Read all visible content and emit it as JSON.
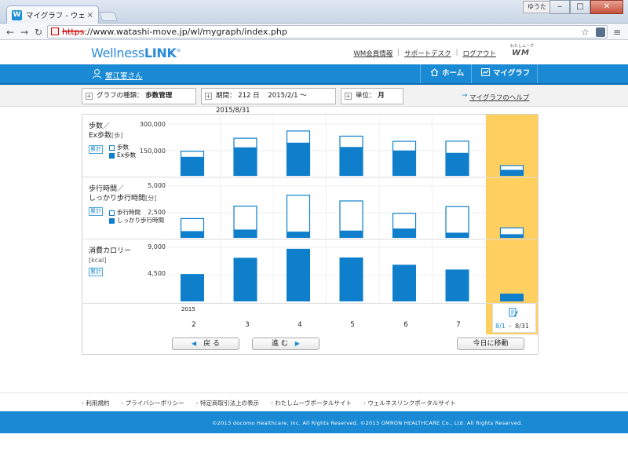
{
  "browser": {
    "tab_title": "マイグラフ - ウェルネス",
    "tab_close": "×",
    "user_badge": "ゆうた",
    "win_minimize": "‒",
    "win_maximize": "□",
    "win_close": "✕",
    "url_protocol": "https",
    "url_rest": "://www.watashi-move.jp/wl/mygraph/index.php",
    "back_icon": "arrow-left-icon",
    "forward_icon": "arrow-right-icon",
    "reload_icon": "reload-icon",
    "back_glyph": "←",
    "forward_glyph": "→",
    "reload_glyph": "↻",
    "star_glyph": "☆",
    "menu_glyph": "≡"
  },
  "header": {
    "logo_light": "Wellness",
    "logo_bold": "LINK",
    "logo_mark": "®",
    "links": [
      "WM会員情報",
      "サポートデスク",
      "ログアウト"
    ],
    "wm_logo_text": "WM",
    "wm_logo_small": "わたしムーヴ"
  },
  "nav": {
    "username": "蟹江軍さん",
    "home": "ホーム",
    "mygraph": "マイグラフ"
  },
  "filters": {
    "type_label": "グラフの種類：",
    "type_value": "歩数管理",
    "period_label": "期間：",
    "period_days": "212 日",
    "period_range": "2015/2/1 〜 2015/8/31",
    "unit_label": "単位：",
    "unit_value": "月",
    "help": "マイグラフのヘルプ"
  },
  "graph": {
    "rows": [
      {
        "title": "歩数／",
        "title2": "Ex歩数",
        "unit": "[歩]",
        "badge": "累計",
        "legend": [
          "歩数",
          "Ex歩数"
        ],
        "ticks": [
          "300,000",
          "150,000"
        ]
      },
      {
        "title": "歩行時間／",
        "title2": "しっかり歩行時間",
        "unit": "[分]",
        "badge": "累計",
        "legend": [
          "歩行時間",
          "しっかり歩行時間"
        ],
        "ticks": [
          "5,000",
          "2,500"
        ]
      },
      {
        "title": "消費カロリー",
        "title2": "",
        "unit": "[kcal]",
        "badge": "累計",
        "legend": [],
        "ticks": [
          "9,000",
          "4,500"
        ]
      }
    ],
    "year": "2015",
    "months": [
      "2",
      "3",
      "4",
      "5",
      "6",
      "7"
    ],
    "current_period_start": "8/1",
    "current_period_dash": "-",
    "current_period_end": "8/31",
    "buttons": {
      "back": "戻 る",
      "next": "進 む",
      "today": "今日に移動"
    },
    "back_arrow": "◀",
    "next_arrow": "▶"
  },
  "chart_data": [
    {
      "type": "bar",
      "ylabel": "歩数／Ex歩数 [歩]",
      "categories": [
        "2",
        "3",
        "4",
        "5",
        "6",
        "7",
        "8"
      ],
      "ylim": [
        0,
        300000
      ],
      "series": [
        {
          "name": "歩数",
          "values": [
            145000,
            220000,
            262000,
            232000,
            202000,
            203000,
            62000
          ]
        },
        {
          "name": "Ex歩数",
          "values": [
            110000,
            165000,
            192000,
            167000,
            147000,
            133000,
            35000
          ]
        }
      ]
    },
    {
      "type": "bar",
      "ylabel": "歩行時間／しっかり歩行時間 [分]",
      "categories": [
        "2",
        "3",
        "4",
        "5",
        "6",
        "7",
        "8"
      ],
      "ylim": [
        0,
        5000
      ],
      "series": [
        {
          "name": "歩行時間",
          "values": [
            1900,
            3100,
            4150,
            3600,
            2400,
            3050,
            1000
          ]
        },
        {
          "name": "しっかり歩行時間",
          "values": [
            650,
            800,
            600,
            700,
            900,
            500,
            350
          ]
        }
      ]
    },
    {
      "type": "bar",
      "ylabel": "消費カロリー [kcal]",
      "categories": [
        "2",
        "3",
        "4",
        "5",
        "6",
        "7",
        "8"
      ],
      "ylim": [
        0,
        9000
      ],
      "series": [
        {
          "name": "消費カロリー",
          "values": [
            4550,
            7250,
            8750,
            7300,
            6100,
            5300,
            1300
          ]
        }
      ]
    }
  ],
  "footer": {
    "links": [
      "利用規約",
      "プライバシーポリシー",
      "特定商取引法上の表示",
      "わたしムーヴポータルサイト",
      "ウェルネスリンクポータルサイト"
    ],
    "copyright": "©2013 docomo Healthcare, Inc. All Rights Reserved. ©2013 OMRON HEALTHCARE Co., Ltd. All Rights Reserved."
  },
  "colors": {
    "brand_blue": "#1a8ad4",
    "bar_blue": "#0f7fcc",
    "highlight": "#ffd060"
  }
}
